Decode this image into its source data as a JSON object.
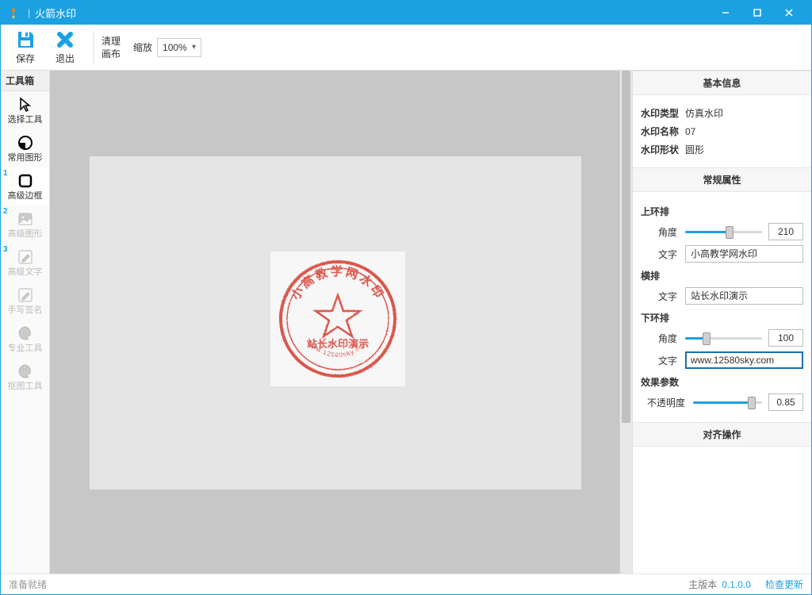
{
  "titlebar": {
    "title": "火箭水印"
  },
  "toolbar": {
    "save_label": "保存",
    "exit_label": "退出",
    "clear_line1": "清理",
    "clear_line2": "画布",
    "zoom_label": "缩放",
    "zoom_value": "100%"
  },
  "toolbox": {
    "header": "工具箱",
    "items": [
      {
        "label": "选择工具",
        "badge": ""
      },
      {
        "label": "常用图形",
        "badge": ""
      },
      {
        "label": "高级边框",
        "badge": "1",
        "selected": true
      },
      {
        "label": "高级图形",
        "badge": "2",
        "disabled": true
      },
      {
        "label": "高级文字",
        "badge": "3",
        "disabled": true
      },
      {
        "label": "手写签名",
        "badge": "",
        "disabled": true
      },
      {
        "label": "专业工具",
        "badge": "",
        "disabled": true
      },
      {
        "label": "抠图工具",
        "badge": "",
        "disabled": true
      }
    ]
  },
  "stamp": {
    "top_arc": "小高教学网水印",
    "middle": "站长水印演示",
    "bottom_arc": "www.12580sky.com"
  },
  "props": {
    "basic": {
      "header": "基本信息",
      "type_label": "水印类型",
      "type_value": "仿真水印",
      "name_label": "水印名称",
      "name_value": "07",
      "shape_label": "水印形状",
      "shape_value": "圆形"
    },
    "general": {
      "header": "常规属性",
      "upper_label": "上环排",
      "angle_label": "角度",
      "text_label": "文字",
      "upper_angle": "210",
      "upper_text": "小高教学网水印",
      "horiz_label": "横排",
      "horiz_text": "站长水印演示",
      "lower_label": "下环排",
      "lower_angle": "100",
      "lower_text": "www.12580sky.com",
      "effect_label": "效果参数",
      "opacity_label": "不透明度",
      "opacity_value": "0.85"
    },
    "align": {
      "header": "对齐操作"
    }
  },
  "statusbar": {
    "ready": "准备就绪",
    "version_label": "主版本",
    "version_value": "0.1.0.0",
    "check_update": "检查更新"
  }
}
